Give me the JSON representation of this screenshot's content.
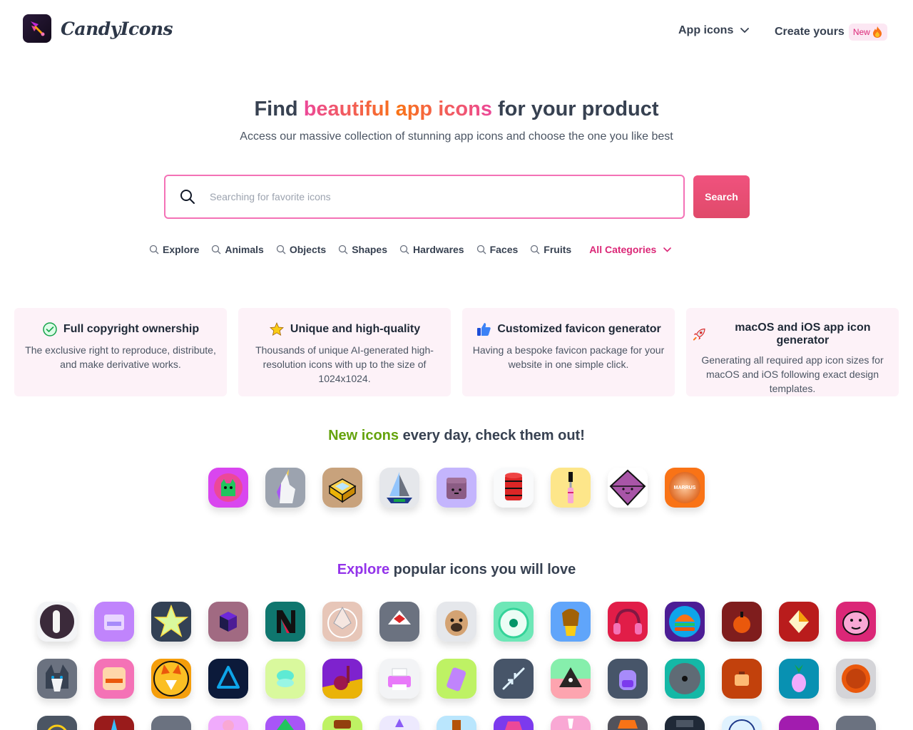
{
  "header": {
    "brand": "CandyIcons",
    "nav_app_icons": "App icons",
    "nav_create": "Create yours",
    "badge_new": "New"
  },
  "hero": {
    "title_pre": "Find ",
    "title_highlight": "beautiful app icons",
    "title_post": " for your product",
    "subtitle": "Access our massive collection of stunning app icons and choose the one you like best"
  },
  "search": {
    "placeholder": "Searching for favorite icons",
    "button": "Search"
  },
  "categories": [
    "Explore",
    "Animals",
    "Objects",
    "Shapes",
    "Hardwares",
    "Faces",
    "Fruits"
  ],
  "all_categories": "All Categories",
  "features": [
    {
      "icon": "check-circle-icon",
      "title": "Full copyright ownership",
      "desc": "The exclusive right to reproduce, distribute, and make derivative works."
    },
    {
      "icon": "star-icon",
      "title": "Unique and high-quality",
      "desc": "Thousands of unique AI-generated high-resolution icons with up to the size of 1024x1024."
    },
    {
      "icon": "thumbs-up-icon",
      "title": "Customized favicon generator",
      "desc": "Having a bespoke favicon package for your website in one simple click."
    },
    {
      "icon": "rocket-icon",
      "title": "macOS and iOS app icon generator",
      "desc": "Generating all required app icon sizes for macOS and iOS following exact design templates."
    }
  ],
  "new_icons": {
    "highlight": "New icons",
    "rest": " every day, check them out!",
    "icons": [
      "green-cat-icon",
      "unicorn-icon",
      "box-icon",
      "sailboat-icon",
      "purple-box-icon",
      "red-cylinder-icon",
      "mascara-icon",
      "purple-gem-icon",
      "marrus-planet-icon"
    ],
    "marrus_label": "MARRUS"
  },
  "explore": {
    "highlight": "Explore",
    "rest": " popular icons you will love",
    "row1": [
      "finger-icon",
      "purple-card-icon",
      "gold-star-icon",
      "purple-cube-icon",
      "letter-n-icon",
      "ethereum-icon",
      "red-shape-icon",
      "pug-icon",
      "green-disc-icon",
      "elephant-plant-icon",
      "headphones-icon",
      "burger-icon",
      "orange-bomb-icon",
      "red-gem-icon",
      "bulldog-icon"
    ],
    "row2": [
      "husky-icon",
      "cake-card-icon",
      "corgi-icon",
      "blue-triangle-icon",
      "compact-mirror-icon",
      "vacuum-icon",
      "printer-icon",
      "green-battery-icon",
      "arrows-icon",
      "pyramid-icon",
      "backpack-icon",
      "teal-disc-icon",
      "briefcase-icon",
      "pineapple-icon",
      "orange-planet-icon"
    ]
  }
}
